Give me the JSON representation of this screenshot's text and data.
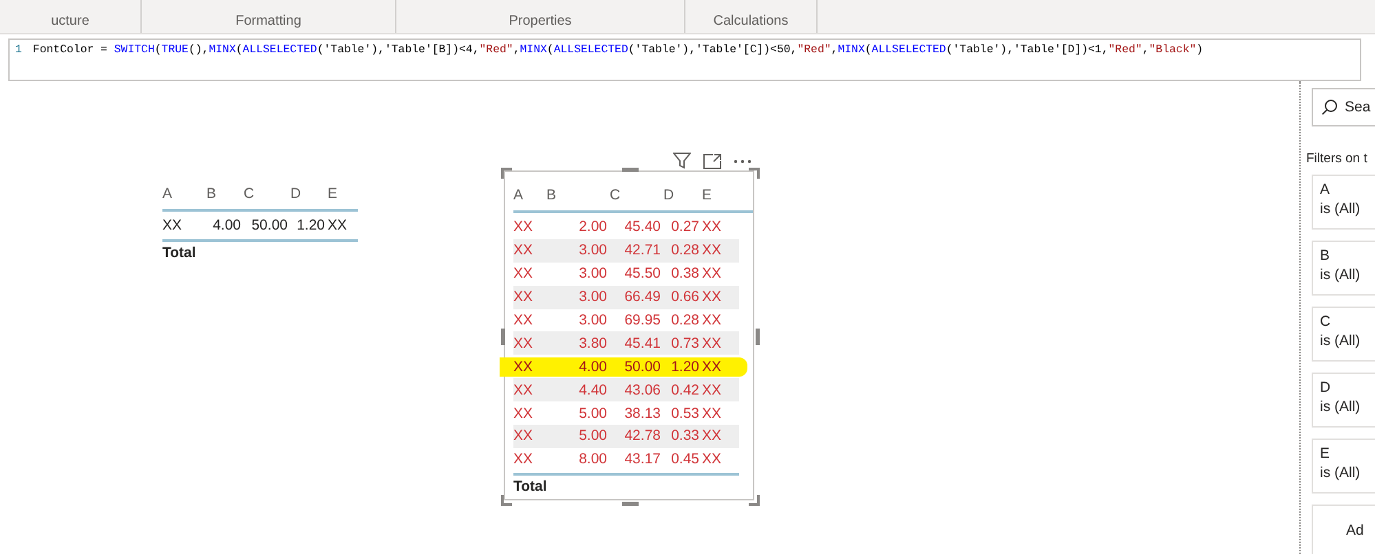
{
  "ribbon": {
    "groups": [
      "ucture",
      "Formatting",
      "Properties",
      "Calculations"
    ]
  },
  "formula_bar": {
    "line_number": "1",
    "segments": [
      {
        "kind": "plain",
        "text": "FontColor = "
      },
      {
        "kind": "func",
        "text": "SWITCH"
      },
      {
        "kind": "plain",
        "text": "("
      },
      {
        "kind": "func",
        "text": "TRUE"
      },
      {
        "kind": "plain",
        "text": "(),"
      },
      {
        "kind": "func",
        "text": "MINX"
      },
      {
        "kind": "plain",
        "text": "("
      },
      {
        "kind": "func",
        "text": "ALLSELECTED"
      },
      {
        "kind": "plain",
        "text": "('Table'),'Table'[B])<4,"
      },
      {
        "kind": "string",
        "text": "\"Red\""
      },
      {
        "kind": "plain",
        "text": ","
      },
      {
        "kind": "func",
        "text": "MINX"
      },
      {
        "kind": "plain",
        "text": "("
      },
      {
        "kind": "func",
        "text": "ALLSELECTED"
      },
      {
        "kind": "plain",
        "text": "('Table'),'Table'[C])<50,"
      },
      {
        "kind": "string",
        "text": "\"Red\""
      },
      {
        "kind": "plain",
        "text": ","
      },
      {
        "kind": "func",
        "text": "MINX"
      },
      {
        "kind": "plain",
        "text": "("
      },
      {
        "kind": "func",
        "text": "ALLSELECTED"
      },
      {
        "kind": "plain",
        "text": "('Table'),'Table'[D])<1,"
      },
      {
        "kind": "string",
        "text": "\"Red\""
      },
      {
        "kind": "plain",
        "text": ","
      },
      {
        "kind": "string",
        "text": "\"Black\""
      },
      {
        "kind": "plain",
        "text": ")"
      }
    ]
  },
  "tables": [
    {
      "columns": [
        "A",
        "B",
        "C",
        "D",
        "E"
      ],
      "rows": [
        {
          "cells": [
            "XX",
            "4.00",
            "50.00",
            "1.20",
            "XX"
          ],
          "highlighted": false
        }
      ],
      "total": "Total"
    },
    {
      "columns": [
        "A",
        "B",
        "C",
        "D",
        "E"
      ],
      "rows": [
        {
          "cells": [
            "XX",
            "2.00",
            "45.40",
            "0.27",
            "XX"
          ],
          "highlighted": false
        },
        {
          "cells": [
            "XX",
            "3.00",
            "42.71",
            "0.28",
            "XX"
          ],
          "highlighted": false
        },
        {
          "cells": [
            "XX",
            "3.00",
            "45.50",
            "0.38",
            "XX"
          ],
          "highlighted": false
        },
        {
          "cells": [
            "XX",
            "3.00",
            "66.49",
            "0.66",
            "XX"
          ],
          "highlighted": false
        },
        {
          "cells": [
            "XX",
            "3.00",
            "69.95",
            "0.28",
            "XX"
          ],
          "highlighted": false
        },
        {
          "cells": [
            "XX",
            "3.80",
            "45.41",
            "0.73",
            "XX"
          ],
          "highlighted": false
        },
        {
          "cells": [
            "XX",
            "4.00",
            "50.00",
            "1.20",
            "XX"
          ],
          "highlighted": true
        },
        {
          "cells": [
            "XX",
            "4.40",
            "43.06",
            "0.42",
            "XX"
          ],
          "highlighted": false
        },
        {
          "cells": [
            "XX",
            "5.00",
            "38.13",
            "0.53",
            "XX"
          ],
          "highlighted": false
        },
        {
          "cells": [
            "XX",
            "5.00",
            "42.78",
            "0.33",
            "XX"
          ],
          "highlighted": false
        },
        {
          "cells": [
            "XX",
            "8.00",
            "43.17",
            "0.45",
            "XX"
          ],
          "highlighted": false
        }
      ],
      "total": "Total"
    }
  ],
  "filters": {
    "search_placeholder": "Sea",
    "heading": "Filters on t",
    "cards": [
      {
        "field": "A",
        "condition": "is (All)"
      },
      {
        "field": "B",
        "condition": "is (All)"
      },
      {
        "field": "C",
        "condition": "is (All)"
      },
      {
        "field": "D",
        "condition": "is (All)"
      },
      {
        "field": "E",
        "condition": "is (All)"
      }
    ],
    "add_label": "Ad"
  }
}
